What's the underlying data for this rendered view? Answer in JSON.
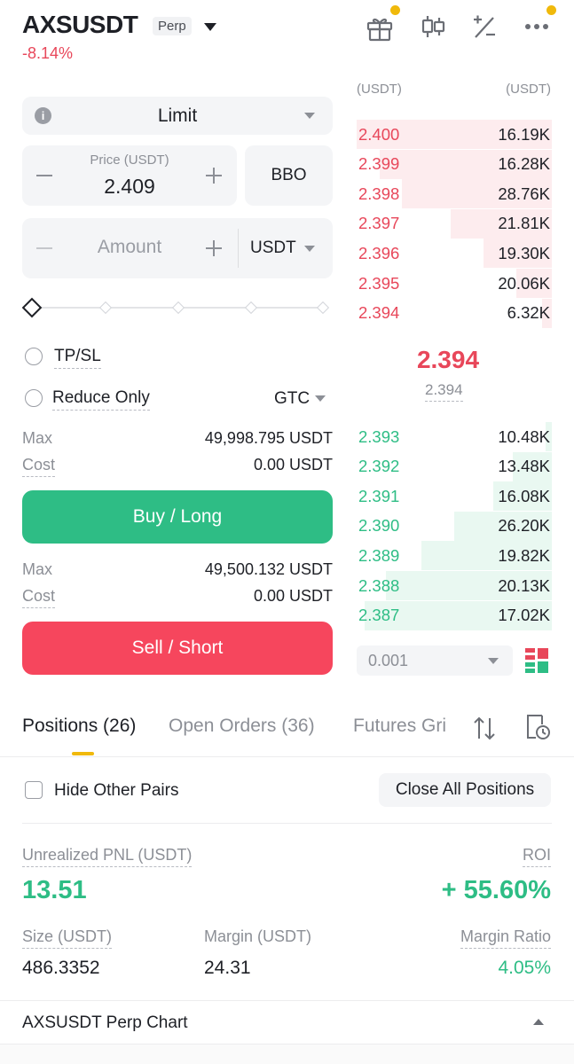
{
  "header": {
    "pair": "AXSUSDT",
    "badge": "Perp",
    "change": "-8.14%"
  },
  "icons": {
    "gift": "gift-icon",
    "candles": "candlestick-icon",
    "calc": "calculator-icon",
    "more": "more-icon"
  },
  "form": {
    "order_type": "Limit",
    "price_label": "Price (USDT)",
    "price_value": "2.409",
    "bbo": "BBO",
    "amount_placeholder": "Amount",
    "amount_unit": "USDT",
    "tpsl": "TP/SL",
    "reduce_only": "Reduce Only",
    "tif": "GTC",
    "buy": {
      "max_label": "Max",
      "max_value": "49,998.795 USDT",
      "cost_label": "Cost",
      "cost_value": "0.00 USDT",
      "button": "Buy / Long"
    },
    "sell": {
      "max_label": "Max",
      "max_value": "49,500.132 USDT",
      "cost_label": "Cost",
      "cost_value": "0.00 USDT",
      "button": "Sell / Short"
    }
  },
  "orderbook": {
    "col_price": "(USDT)",
    "col_amount": "(USDT)",
    "asks": [
      {
        "price": "2.400",
        "qty": "16.19K",
        "depth": 1.0
      },
      {
        "price": "2.399",
        "qty": "16.28K",
        "depth": 0.88
      },
      {
        "price": "2.398",
        "qty": "28.76K",
        "depth": 0.77
      },
      {
        "price": "2.397",
        "qty": "21.81K",
        "depth": 0.52
      },
      {
        "price": "2.396",
        "qty": "19.30K",
        "depth": 0.35
      },
      {
        "price": "2.395",
        "qty": "20.06K",
        "depth": 0.18
      },
      {
        "price": "2.394",
        "qty": "6.32K",
        "depth": 0.05
      }
    ],
    "last_price": "2.394",
    "mark_price": "2.394",
    "bids": [
      {
        "price": "2.393",
        "qty": "10.48K",
        "depth": 0.03
      },
      {
        "price": "2.392",
        "qty": "13.48K",
        "depth": 0.2
      },
      {
        "price": "2.391",
        "qty": "16.08K",
        "depth": 0.3
      },
      {
        "price": "2.390",
        "qty": "26.20K",
        "depth": 0.5
      },
      {
        "price": "2.389",
        "qty": "19.82K",
        "depth": 0.67
      },
      {
        "price": "2.388",
        "qty": "20.13K",
        "depth": 0.85
      },
      {
        "price": "2.387",
        "qty": "17.02K",
        "depth": 0.96
      }
    ],
    "precision": "0.001"
  },
  "tabs": {
    "positions": "Positions (26)",
    "open_orders": "Open Orders (36)",
    "futures_grid": "Futures Gri"
  },
  "positions": {
    "hide_other": "Hide Other Pairs",
    "close_all": "Close All Positions",
    "pnl_label": "Unrealized PNL (USDT)",
    "pnl_value": "13.51",
    "roi_label": "ROI",
    "roi_value": "+ 55.60%",
    "size_label": "Size (USDT)",
    "size_value": "486.3352",
    "margin_label": "Margin (USDT)",
    "margin_value": "24.31",
    "ratio_label": "Margin Ratio",
    "ratio_value": "4.05%"
  },
  "chart_bar": {
    "title": "AXSUSDT Perp Chart"
  },
  "colors": {
    "red": "#e8475a",
    "green": "#2ebd85",
    "accent": "#f0b90b"
  }
}
